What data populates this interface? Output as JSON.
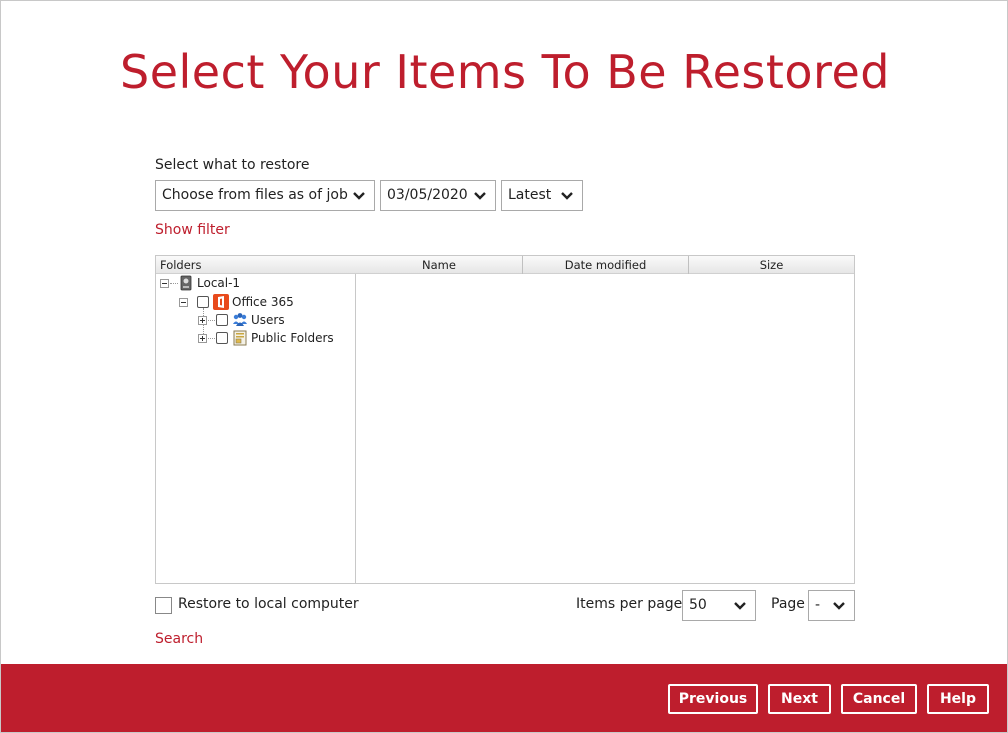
{
  "title": "Select Your Items To Be Restored",
  "restore_section": {
    "label": "Select what to restore",
    "mode_select": "Choose from files as of job",
    "date_select": "03/05/2020",
    "version_select": "Latest",
    "show_filter": "Show filter"
  },
  "browser": {
    "folders_header": "Folders",
    "columns": [
      "Name",
      "Date modified",
      "Size"
    ],
    "tree": [
      {
        "label": "Local-1",
        "icon": "drive-icon"
      },
      {
        "label": "Office 365",
        "icon": "office365-icon"
      },
      {
        "label": "Users",
        "icon": "users-icon"
      },
      {
        "label": "Public Folders",
        "icon": "public-folders-icon"
      }
    ]
  },
  "options": {
    "restore_local": "Restore to local computer",
    "items_per_page_label": "Items per page",
    "items_per_page": "50",
    "page_label": "Page",
    "page_value": "-",
    "search": "Search"
  },
  "footer": {
    "previous": "Previous",
    "next": "Next",
    "cancel": "Cancel",
    "help": "Help"
  },
  "colors": {
    "accent": "#be1e2d"
  }
}
